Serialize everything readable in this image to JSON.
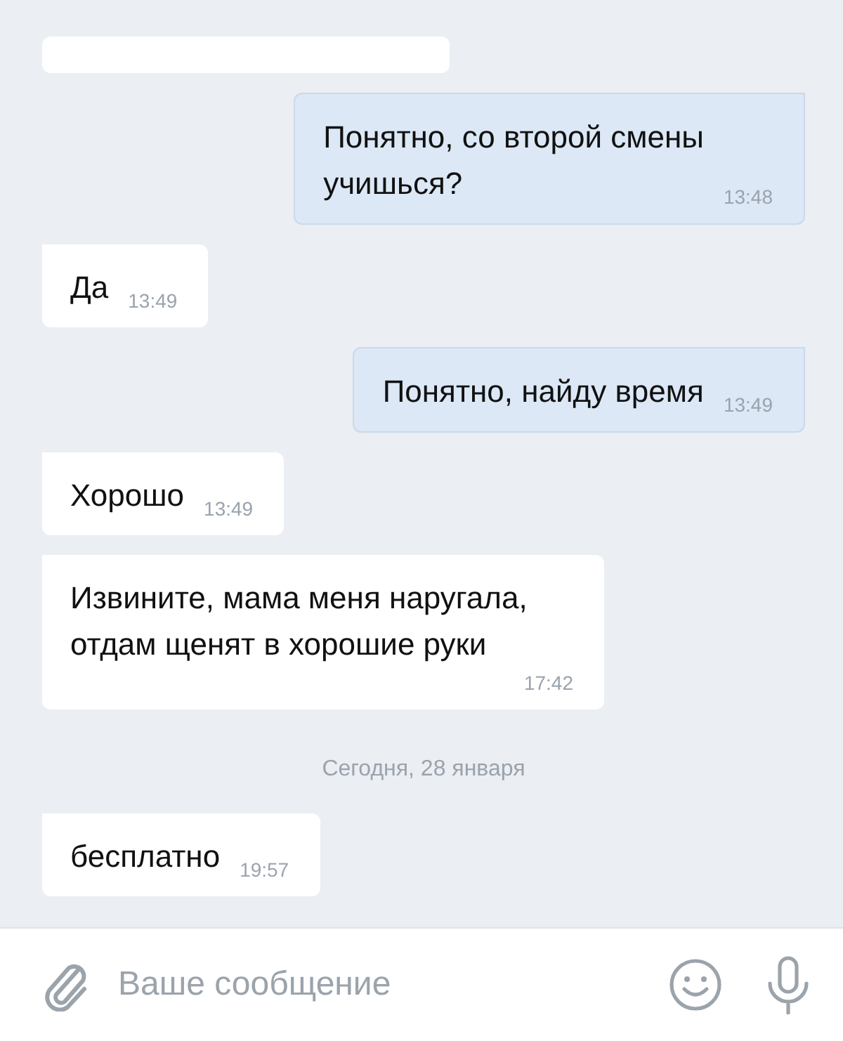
{
  "messages": [
    {
      "kind": "outgoing",
      "text": "Понятно, со второй смены\nучишься?",
      "time": "13:48"
    },
    {
      "kind": "incoming",
      "text": "Да",
      "time": "13:49"
    },
    {
      "kind": "outgoing",
      "text": "Понятно, найду время",
      "time": "13:49"
    },
    {
      "kind": "incoming",
      "text": "Хорошо",
      "time": "13:49"
    },
    {
      "kind": "incoming",
      "text": "Извините, мама меня наругала,\nотдам щенят в хорошие руки",
      "time": "17:42"
    },
    {
      "kind": "date",
      "text": "Сегодня, 28 января"
    },
    {
      "kind": "incoming",
      "text": "бесплатно",
      "time": "19:57"
    }
  ],
  "composer": {
    "placeholder": "Ваше сообщение"
  }
}
